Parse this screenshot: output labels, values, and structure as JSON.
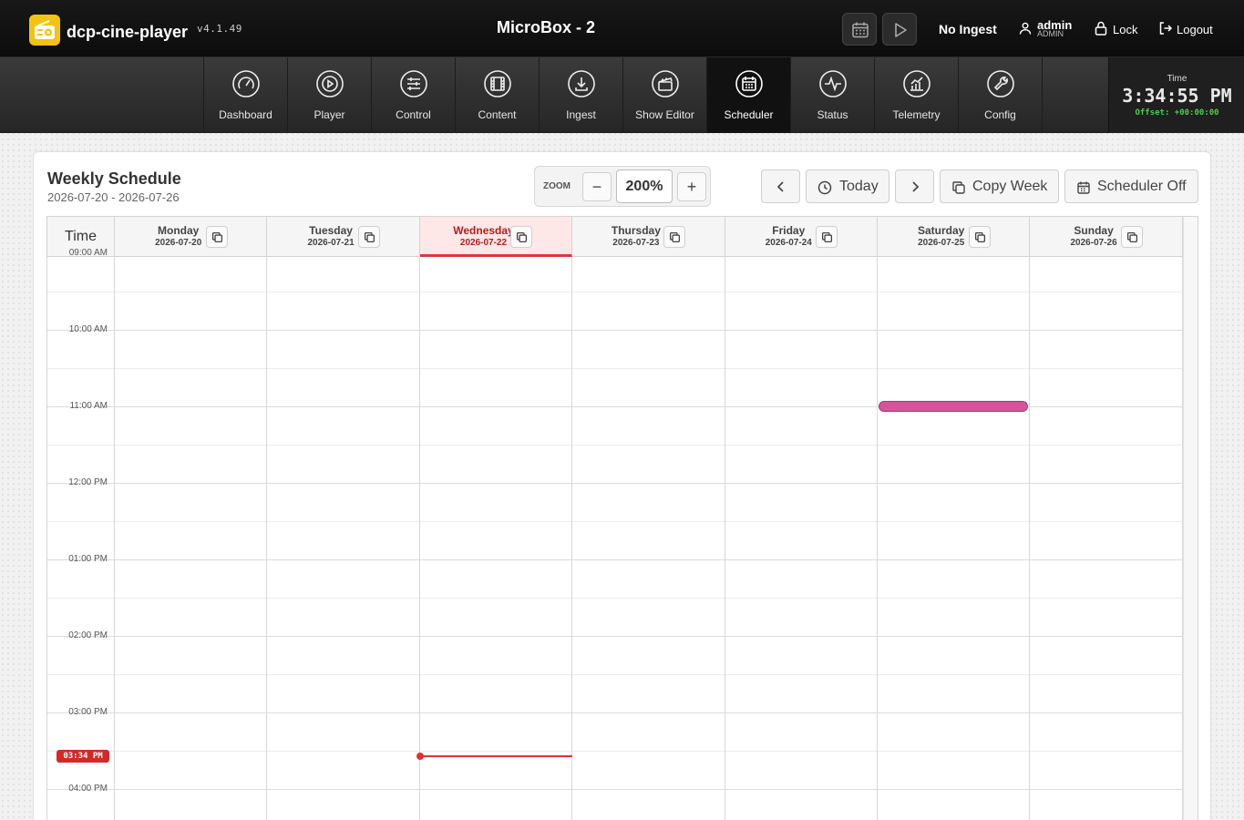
{
  "app": {
    "name": "dcp-cine-player",
    "version": "v4.1.49",
    "device_title": "MicroBox - 2"
  },
  "header": {
    "ingest_status": "No Ingest",
    "user": {
      "name": "admin",
      "role": "ADMIN"
    },
    "lock_label": "Lock",
    "logout_label": "Logout"
  },
  "nav": {
    "tabs": [
      {
        "label": "Dashboard",
        "icon": "gauge-icon"
      },
      {
        "label": "Player",
        "icon": "play-circle-icon"
      },
      {
        "label": "Control",
        "icon": "sliders-icon"
      },
      {
        "label": "Content",
        "icon": "film-icon"
      },
      {
        "label": "Ingest",
        "icon": "download-icon"
      },
      {
        "label": "Show Editor",
        "icon": "clapperboard-icon"
      },
      {
        "label": "Scheduler",
        "icon": "calendar-icon",
        "active": true
      },
      {
        "label": "Status",
        "icon": "activity-icon"
      },
      {
        "label": "Telemetry",
        "icon": "chart-icon"
      },
      {
        "label": "Config",
        "icon": "wrench-icon"
      }
    ]
  },
  "clock": {
    "label": "Time",
    "time": "3:34:55 PM",
    "offset": "Offset: +00:00:00"
  },
  "schedule": {
    "title": "Weekly Schedule",
    "range": "2026-07-20 - 2026-07-26",
    "zoom_label": "ZOOM",
    "zoom_value": "200%",
    "zoom_out": "−",
    "zoom_in": "+",
    "today_label": "Today",
    "copy_week_label": "Copy Week",
    "scheduler_toggle_label": "Scheduler Off",
    "time_header": "Time",
    "days": [
      {
        "name": "Monday",
        "date": "2026-07-20"
      },
      {
        "name": "Tuesday",
        "date": "2026-07-21"
      },
      {
        "name": "Wednesday",
        "date": "2026-07-22",
        "today": true
      },
      {
        "name": "Thursday",
        "date": "2026-07-23"
      },
      {
        "name": "Friday",
        "date": "2026-07-24"
      },
      {
        "name": "Saturday",
        "date": "2026-07-25"
      },
      {
        "name": "Sunday",
        "date": "2026-07-26"
      }
    ],
    "hours": [
      "09:00 AM",
      "10:00 AM",
      "11:00 AM",
      "12:00 PM",
      "01:00 PM",
      "02:00 PM",
      "03:00 PM",
      "04:00 PM"
    ],
    "now_badge": "03:34 PM",
    "events": [
      {
        "day_index": 5,
        "start": "11:00 AM"
      }
    ],
    "colors": {
      "event": "#d4559b",
      "now": "#e03131",
      "today_header": "#fde7e7",
      "accent": "#f3c313"
    }
  }
}
